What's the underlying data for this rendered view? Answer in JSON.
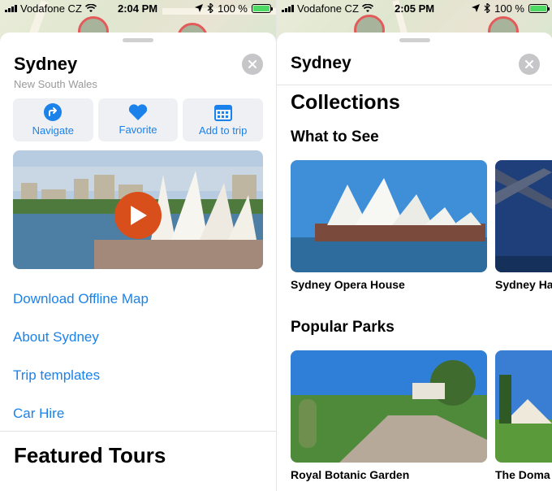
{
  "left": {
    "status": {
      "carrier": "Vodafone CZ",
      "time": "2:04 PM",
      "battery": "100 %"
    },
    "sheet": {
      "title": "Sydney",
      "subtitle": "New South Wales",
      "actions": [
        {
          "label": "Navigate",
          "icon": "navigate-arrow-icon"
        },
        {
          "label": "Favorite",
          "icon": "heart-icon"
        },
        {
          "label": "Add to trip",
          "icon": "calendar-icon"
        }
      ],
      "links": [
        "Download Offline Map",
        "About Sydney",
        "Trip templates",
        "Car Hire"
      ],
      "featured_heading": "Featured Tours"
    }
  },
  "right": {
    "status": {
      "carrier": "Vodafone CZ",
      "time": "2:05 PM",
      "battery": "100 %"
    },
    "sheet": {
      "title": "Sydney",
      "collections_heading": "Collections",
      "sections": [
        {
          "heading": "What to See",
          "items": [
            "Sydney Opera House",
            "Sydney Ha"
          ]
        },
        {
          "heading": "Popular Parks",
          "items": [
            "Royal Botanic Garden",
            "The Doma"
          ]
        }
      ]
    }
  },
  "colors": {
    "accent": "#1a82ea",
    "battery": "#4cd964",
    "play": "#d84f1c"
  }
}
